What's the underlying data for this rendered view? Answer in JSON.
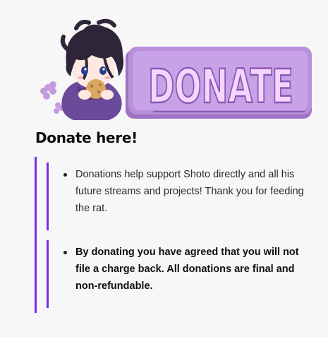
{
  "panel": {
    "banner_text": "DONATE",
    "title": "Donate here!",
    "items": [
      "Donations help support Shoto directly and all his future streams and projects! Thank you for feeding the rat.",
      "By donating you have agreed that you will not file a charge back. All donations are final and non-refundable."
    ]
  },
  "colors": {
    "accent": "#772ce8",
    "banner_purple": "#b68ad6",
    "banner_text": "#f3d6ff"
  }
}
